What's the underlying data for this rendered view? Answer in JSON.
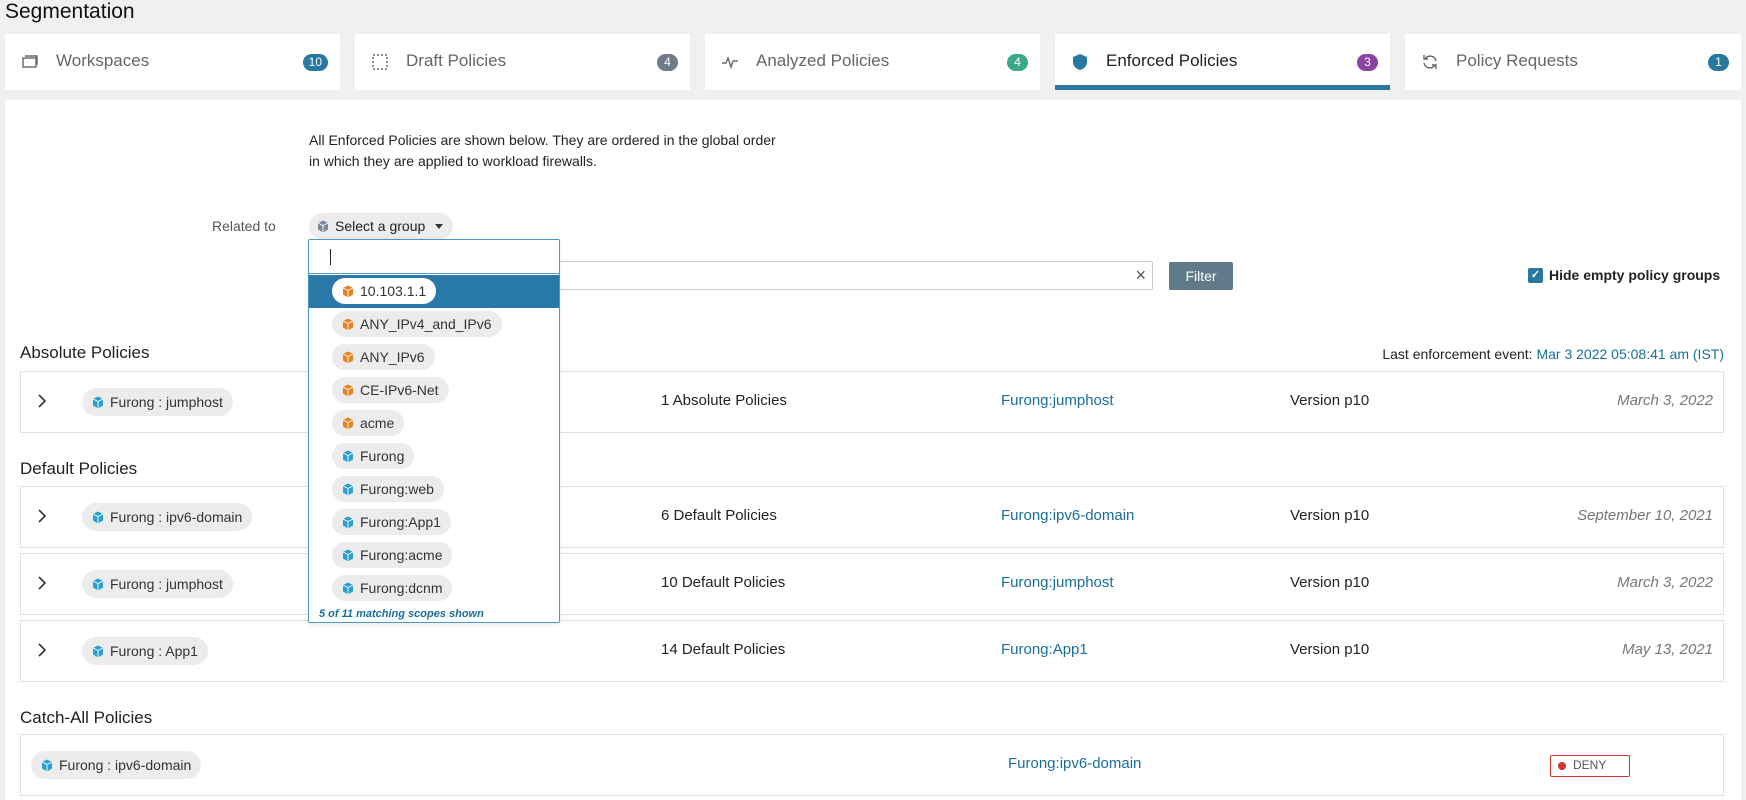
{
  "page": {
    "title": "Segmentation"
  },
  "tabs": [
    {
      "label": "Workspaces",
      "count": "10",
      "icon": "workspace-icon",
      "badge_color": "#2878a0"
    },
    {
      "label": "Draft Policies",
      "count": "4",
      "icon": "draft-icon",
      "badge_color": "#6e7b8a"
    },
    {
      "label": "Analyzed Policies",
      "count": "4",
      "icon": "pulse-icon",
      "badge_color": "#3aa88a"
    },
    {
      "label": "Enforced Policies",
      "count": "3",
      "icon": "shield-icon",
      "badge_color": "#8a44a0",
      "active": true
    },
    {
      "label": "Policy Requests",
      "count": "1",
      "icon": "refresh-icon",
      "badge_color": "#2878a0"
    }
  ],
  "description": "All Enforced Policies are shown below. They are ordered in the global order in which they are applied to workload firewalls.",
  "filter": {
    "related_label": "Related to",
    "group_select": "Select a group",
    "button": "Filter",
    "hide_empty": "Hide empty policy groups",
    "hide_empty_checked": true
  },
  "dropdown": {
    "items": [
      {
        "label": "10.103.1.1",
        "color": "#e8821e",
        "selected": true
      },
      {
        "label": "ANY_IPv4_and_IPv6",
        "color": "#e8821e"
      },
      {
        "label": "ANY_IPv6",
        "color": "#e8821e"
      },
      {
        "label": "CE-IPv6-Net",
        "color": "#e8821e"
      },
      {
        "label": "acme",
        "color": "#e8821e"
      },
      {
        "label": "Furong",
        "color": "#2a9fd0"
      },
      {
        "label": "Furong:web",
        "color": "#2a9fd0"
      },
      {
        "label": "Furong:App1",
        "color": "#2a9fd0"
      },
      {
        "label": "Furong:acme",
        "color": "#2a9fd0"
      },
      {
        "label": "Furong:dcnm",
        "color": "#2a9fd0"
      }
    ],
    "footer": "5 of 11 matching scopes shown"
  },
  "last_event": {
    "label": "Last enforcement event:",
    "value": "Mar 3 2022 05:08:41 am (IST)"
  },
  "sections": {
    "absolute": "Absolute Policies",
    "default": "Default Policies",
    "catch_all": "Catch-All Policies"
  },
  "absolute_rows": [
    {
      "scope": "Furong : jumphost",
      "count": "1 Absolute Policies",
      "link": "Furong:jumphost",
      "version": "Version p10",
      "date": "March 3, 2022"
    }
  ],
  "default_rows": [
    {
      "scope": "Furong : ipv6-domain",
      "count": "6 Default Policies",
      "link": "Furong:ipv6-domain",
      "version": "Version p10",
      "date": "September 10, 2021"
    },
    {
      "scope": "Furong : jumphost",
      "count": "10 Default Policies",
      "link": "Furong:jumphost",
      "version": "Version p10",
      "date": "March 3, 2022"
    },
    {
      "scope": "Furong : App1",
      "count": "14 Default Policies",
      "link": "Furong:App1",
      "version": "Version p10",
      "date": "May 13, 2021"
    }
  ],
  "catch_all_rows": [
    {
      "scope": "Furong : ipv6-domain",
      "link": "Furong:ipv6-domain",
      "action": "DENY"
    }
  ]
}
